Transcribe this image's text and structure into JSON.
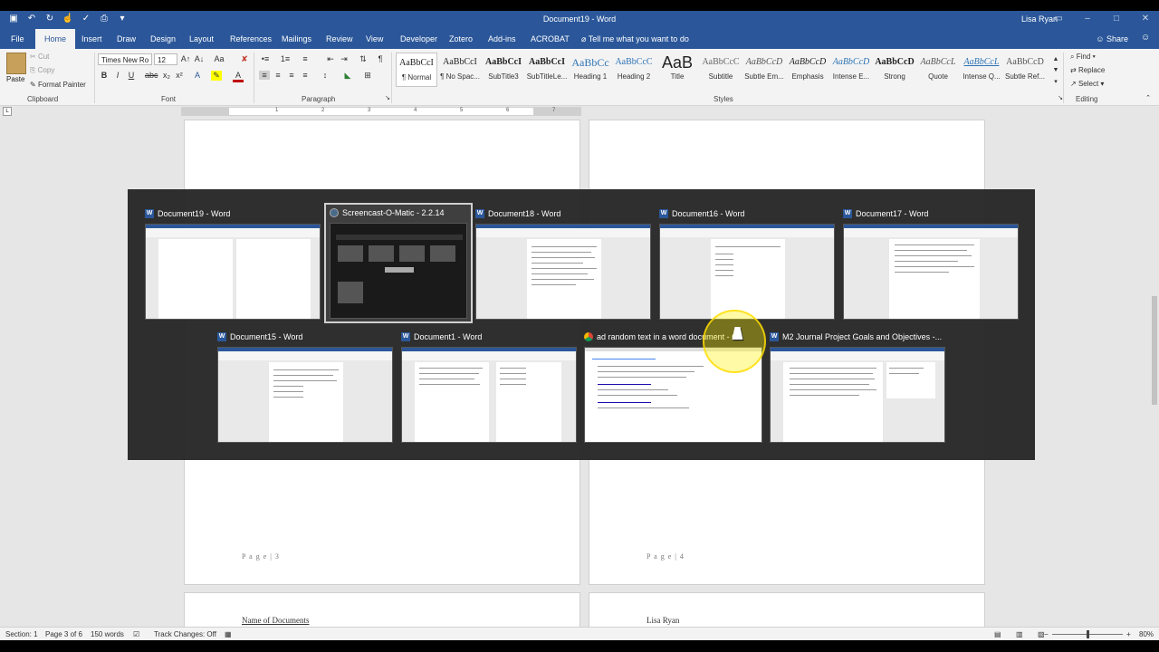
{
  "title_bar": {
    "document_title": "Document19 - Word",
    "user_name": "Lisa Ryan",
    "qat_icons": [
      "save-icon",
      "undo-icon",
      "redo-icon",
      "touch-mode-icon",
      "spelling-icon",
      "print-preview-icon",
      "customize-qat-icon"
    ]
  },
  "tabs": [
    {
      "label": "File"
    },
    {
      "label": "Home"
    },
    {
      "label": "Insert"
    },
    {
      "label": "Draw"
    },
    {
      "label": "Design"
    },
    {
      "label": "Layout"
    },
    {
      "label": "References"
    },
    {
      "label": "Mailings"
    },
    {
      "label": "Review"
    },
    {
      "label": "View"
    },
    {
      "label": "Developer"
    },
    {
      "label": "Zotero"
    },
    {
      "label": "Add-ins"
    },
    {
      "label": "ACROBAT"
    }
  ],
  "active_tab": "Home",
  "tell_me": "Tell me what you want to do",
  "share_label": "Share",
  "clipboard": {
    "paste": "Paste",
    "cut": "Cut",
    "copy": "Copy",
    "format_painter": "Format Painter",
    "group_label": "Clipboard"
  },
  "font": {
    "name": "Times New Ro",
    "size": "12",
    "group_label": "Font"
  },
  "paragraph": {
    "group_label": "Paragraph"
  },
  "styles": {
    "group_label": "Styles",
    "items": [
      {
        "sample": "AaBbCcI",
        "name": "¶ Normal"
      },
      {
        "sample": "AaBbCcI",
        "name": "¶ No Spac..."
      },
      {
        "sample": "AaBbCcI",
        "name": "SubTitle3"
      },
      {
        "sample": "AaBbCcI",
        "name": "SubTitleLe..."
      },
      {
        "sample": "AaBbCc",
        "name": "Heading 1"
      },
      {
        "sample": "AaBbCcC",
        "name": "Heading 2"
      },
      {
        "sample": "AaB",
        "name": "Title"
      },
      {
        "sample": "AaBbCcC",
        "name": "Subtitle"
      },
      {
        "sample": "AaBbCcD",
        "name": "Subtle Em..."
      },
      {
        "sample": "AaBbCcD",
        "name": "Emphasis"
      },
      {
        "sample": "AaBbCcD",
        "name": "Intense E..."
      },
      {
        "sample": "AaBbCcD",
        "name": "Strong"
      },
      {
        "sample": "AaBbCcL",
        "name": "Quote"
      },
      {
        "sample": "AaBbCcL",
        "name": "Intense Q..."
      },
      {
        "sample": "AaBbCcD",
        "name": "Subtle Ref..."
      }
    ]
  },
  "editing": {
    "find": "Find",
    "replace": "Replace",
    "select": "Select",
    "group_label": "Editing"
  },
  "ruler_numbers": [
    "1",
    "2",
    "3",
    "4",
    "5",
    "6",
    "7"
  ],
  "pages": {
    "left_page_num": "P a g e | 3",
    "right_page_num": "P a g e | 4",
    "left_next_text": "Name of Documents",
    "right_next_text": "Lisa Ryan"
  },
  "switcher": {
    "windows": [
      {
        "title": "Document19 - Word",
        "app": "word",
        "selected": false
      },
      {
        "title": "Screencast-O-Matic - 2.2.14",
        "app": "screencast",
        "selected": true
      },
      {
        "title": "Document18 - Word",
        "app": "word",
        "selected": false
      },
      {
        "title": "Document16 - Word",
        "app": "word",
        "selected": false
      },
      {
        "title": "Document17 - Word",
        "app": "word",
        "selected": false
      },
      {
        "title": "Document15 - Word",
        "app": "word",
        "selected": false
      },
      {
        "title": "Document1 - Word",
        "app": "word",
        "selected": false
      },
      {
        "title": "ad random text in a word document - Go",
        "app": "chrome",
        "selected": false
      },
      {
        "title": "M2 Journal Project Goals and Objectives -...",
        "app": "word",
        "selected": false
      }
    ]
  },
  "status_bar": {
    "section": "Section: 1",
    "page": "Page 3 of 6",
    "words": "150 words",
    "track_changes": "Track Changes: Off",
    "zoom": "80%"
  },
  "colors": {
    "word_blue": "#2b579a",
    "ribbon_bg": "#f3f3f3",
    "cursor_highlight": "#fff000"
  }
}
